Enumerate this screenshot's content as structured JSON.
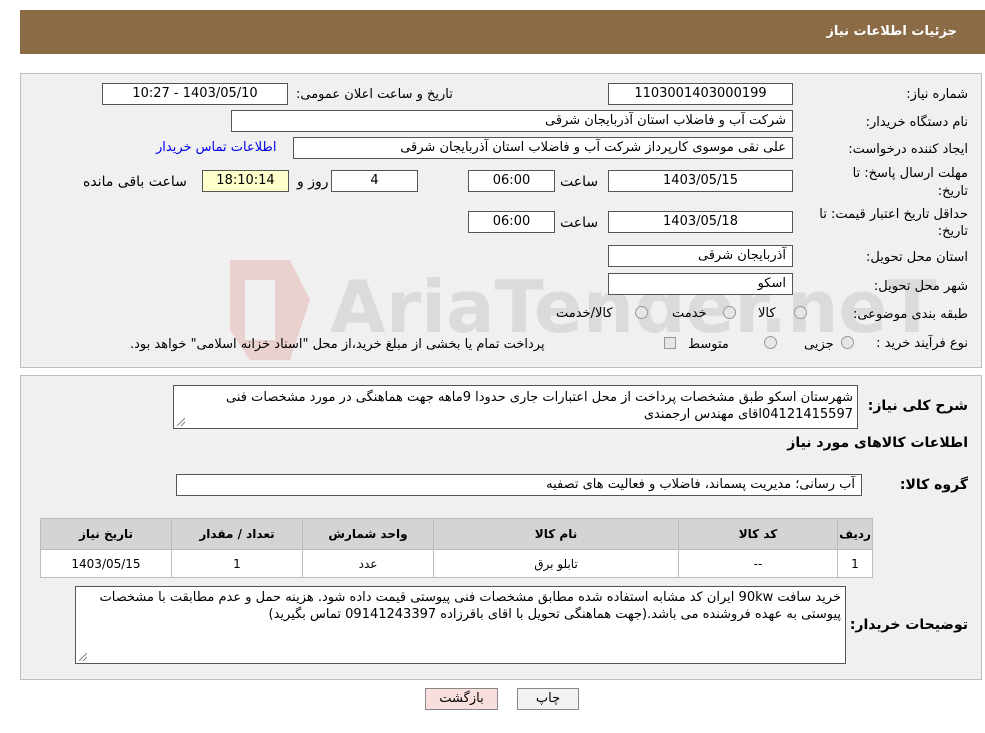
{
  "header": {
    "title": "جزئیات اطلاعات نیاز"
  },
  "form": {
    "need_number_label": "شماره نیاز:",
    "need_number": "1103001403000199",
    "announce_label": "تاریخ و ساعت اعلان عمومی:",
    "announce_value": "1403/05/10 - 10:27",
    "buyer_org_label": "نام دستگاه خریدار:",
    "buyer_org": "شرکت آب و فاضلاب استان آذربایجان شرقی",
    "requester_label": "ایجاد کننده درخواست:",
    "requester": "علی نقی موسوی کارپرداز شرکت آب و فاضلاب استان آذربایجان شرقی",
    "contact_link": "اطلاعات تماس خریدار",
    "deadline_label_1": "مهلت ارسال پاسخ: تا",
    "deadline_label_2": "تاریخ:",
    "deadline_date": "1403/05/15",
    "time_label": "ساعت",
    "deadline_time": "06:00",
    "days_value": "4",
    "days_label": "روز و",
    "remaining_time": "18:10:14",
    "remaining_label": "ساعت باقی مانده",
    "validity_label_1": "حداقل تاریخ اعتبار قیمت: تا",
    "validity_label_2": "تاریخ:",
    "validity_date": "1403/05/18",
    "validity_time": "06:00",
    "province_label": "استان محل تحویل:",
    "province": "آذربایجان شرقی",
    "city_label": "شهر محل تحویل:",
    "city": "اسکو",
    "category_label": "طبقه بندی موضوعی:",
    "category_options": [
      "کالا",
      "خدمت",
      "کالا/خدمت"
    ],
    "process_label": "نوع فرآیند خرید :",
    "process_options": [
      "جزیی",
      "متوسط"
    ],
    "process_note": "پرداخت تمام یا بخشی از مبلغ خرید،از محل \"اسناد خزانه اسلامی\" خواهد بود."
  },
  "description": {
    "label": "شرح کلی نیاز:",
    "text": "شهرستان اسکو   طبق مشخصات پرداخت از محل اعتبارات جاری حدودا 9ماهه جهت هماهنگی در مورد مشخصات فنی 04121415597اقای مهندس ارجمندی"
  },
  "goods": {
    "section_title": "اطلاعات کالاهای مورد نیاز",
    "group_label": "گروه کالا:",
    "group_value": "آب رسانی؛ مدیریت پسماند، فاضلاب و فعالیت های تصفیه",
    "columns": [
      "ردیف",
      "کد کالا",
      "نام کالا",
      "واحد شمارش",
      "تعداد / مقدار",
      "تاریخ نیاز"
    ],
    "rows": [
      [
        "1",
        "--",
        "تابلو برق",
        "عدد",
        "1",
        "1403/05/15"
      ]
    ]
  },
  "buyer_notes": {
    "label": "توضیحات خریدار:",
    "text": "خرید سافت 90kw       ایران کد مشابه استفاده شده مطابق مشخصات فنی پیوستی قیمت داده شود. هزینه حمل و عدم مطابقت با مشخصات پیوستی به عهده فروشنده می باشد.(جهت هماهنگی تحویل با اقای باقرزاده  09141243397 تماس بگیرید)"
  },
  "buttons": {
    "print": "چاپ",
    "back": "بازگشت"
  },
  "watermark": {
    "text": "AriaTender.neT"
  },
  "colors": {
    "header_bg": "#8a6b46",
    "link": "#0000ee",
    "back_button_bg": "#f9dede"
  }
}
